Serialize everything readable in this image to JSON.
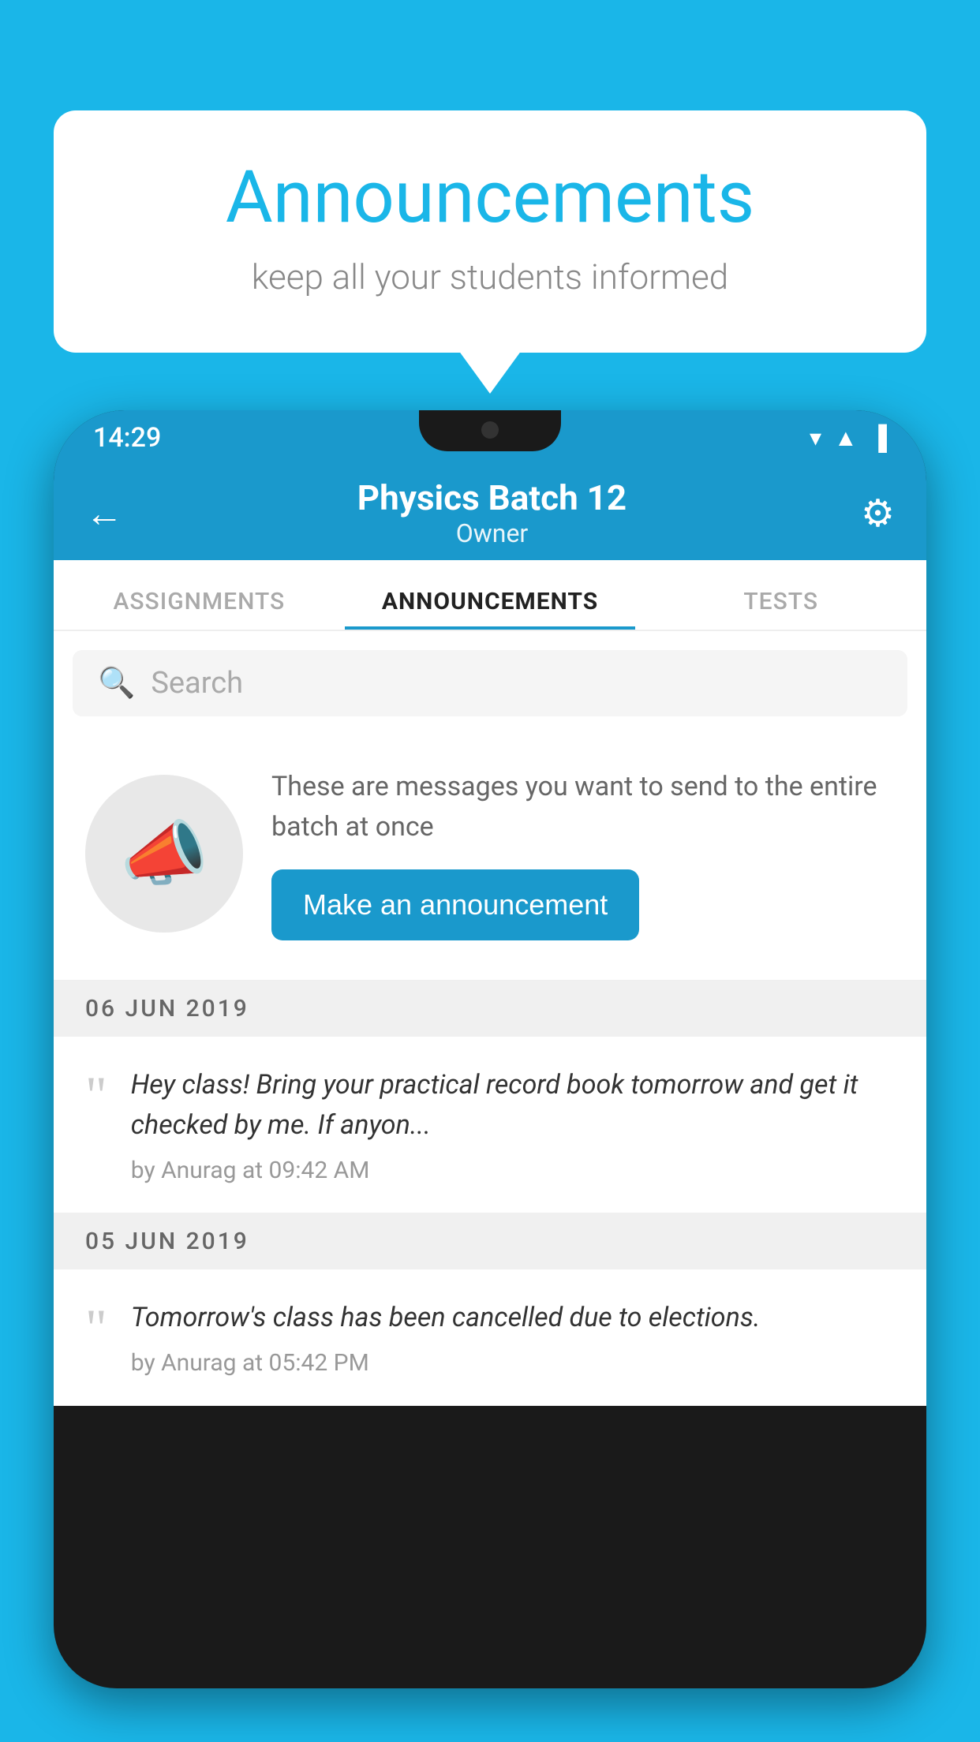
{
  "background_color": "#1ab6e8",
  "speech_bubble": {
    "title": "Announcements",
    "subtitle": "keep all your students informed"
  },
  "phone": {
    "status_bar": {
      "time": "14:29"
    },
    "header": {
      "title": "Physics Batch 12",
      "subtitle": "Owner",
      "back_label": "←",
      "settings_label": "⚙"
    },
    "tabs": [
      {
        "label": "ASSIGNMENTS",
        "active": false
      },
      {
        "label": "ANNOUNCEMENTS",
        "active": true
      },
      {
        "label": "TESTS",
        "active": false
      }
    ],
    "search": {
      "placeholder": "Search"
    },
    "promo": {
      "description": "These are messages you want to send to the entire batch at once",
      "button_label": "Make an announcement"
    },
    "announcements": [
      {
        "date": "06  JUN  2019",
        "text": "Hey class! Bring your practical record book tomorrow and get it checked by me. If anyon...",
        "meta": "by Anurag at 09:42 AM"
      },
      {
        "date": "05  JUN  2019",
        "text": "Tomorrow's class has been cancelled due to elections.",
        "meta": "by Anurag at 05:42 PM"
      }
    ]
  }
}
